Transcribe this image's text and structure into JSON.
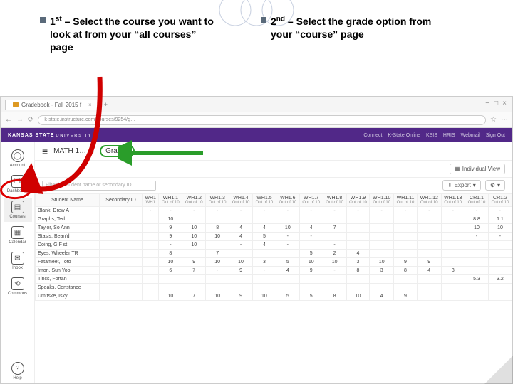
{
  "instructions": {
    "first": "1st – Select the course you want to look at from your “all courses” page",
    "second": "2nd – Select the grade option from  your “course” page"
  },
  "browser": {
    "tab_title": "Gradebook - Fall 2015 f",
    "url": "k-state.instructure.com/courses/9254/g…",
    "window_min": "−",
    "window_max": "□",
    "window_close": "×"
  },
  "ks": {
    "logo": "KANSAS STATE",
    "logo_sub": "U N I V E R S I T Y",
    "right_links": [
      "Connect",
      "K-State Online",
      "KSIS",
      "HRIS",
      "Webmail",
      "Sign Out"
    ]
  },
  "nav": [
    {
      "label": "Account",
      "glyph": "◯"
    },
    {
      "label": "Dashboard",
      "glyph": "❐"
    },
    {
      "label": "Courses",
      "glyph": "▤"
    },
    {
      "label": "Calendar",
      "glyph": "▦"
    },
    {
      "label": "Inbox",
      "glyph": "✉"
    },
    {
      "label": "Commons",
      "glyph": "⟲"
    },
    {
      "label": "Help",
      "glyph": "?"
    }
  ],
  "crumbs": {
    "course": "MATH 1…",
    "page": "Grades"
  },
  "toolbar": {
    "view": "Individual View",
    "export": "Export",
    "gear": "⚙",
    "chev": "▾",
    "grid": "▦"
  },
  "filter_placeholder": "Filter by student name or secondary ID",
  "grid": {
    "head_name": "Student Name",
    "head_sec": "Secondary ID",
    "columns": [
      "WH1",
      "WH1.1",
      "WH1.2",
      "WH1.3",
      "WH1.4",
      "WH1.5",
      "WH1.6",
      "WH1.7",
      "WH1.8",
      "WH1.9",
      "WH1.10",
      "WH1.11",
      "WH1.12",
      "WH1.13",
      "CR1.1",
      "CR1.2"
    ],
    "col_sub": "Out of 10",
    "col_sub_wh1": "WH1",
    "rows": [
      {
        "name": "Blank, Drew A",
        "sec": "",
        "c": [
          "-",
          "-",
          "-",
          "-",
          "-",
          "-",
          "-",
          "-",
          "-",
          "-",
          "-",
          "-",
          "-",
          "-",
          "-",
          "-"
        ]
      },
      {
        "name": "Graphs, Ted",
        "sec": "",
        "c": [
          "",
          "10",
          "",
          "",
          "",
          "",
          "",
          "",
          "",
          "",
          "",
          "",
          "",
          "",
          "8.8",
          "1.1"
        ]
      },
      {
        "name": "Taylor, So Ann",
        "sec": "",
        "c": [
          "",
          "9",
          "10",
          "8",
          "4",
          "4",
          "10",
          "4",
          "7",
          "",
          "",
          "",
          "",
          "",
          "10",
          "10"
        ]
      },
      {
        "name": "Stasis, Bean'd",
        "sec": "",
        "c": [
          "",
          "9",
          "10",
          "10",
          "4",
          "5",
          "-",
          "-",
          "",
          "",
          "",
          "",
          "",
          "",
          "-",
          "-"
        ]
      },
      {
        "name": "Doing, G F st",
        "sec": "",
        "c": [
          "",
          "-",
          "10",
          "",
          "-",
          "4",
          "-",
          "",
          "-",
          "",
          "",
          "",
          "",
          "",
          "",
          ""
        ]
      },
      {
        "name": "Eyes, Wheeler TR",
        "sec": "",
        "c": [
          "",
          "8",
          "",
          "7",
          "",
          "",
          "",
          "5",
          "2",
          "4",
          "",
          "",
          "",
          "",
          "",
          ""
        ]
      },
      {
        "name": "Fatameet, Toto",
        "sec": "",
        "c": [
          "",
          "10",
          "9",
          "10",
          "10",
          "3",
          "5",
          "10",
          "10",
          "3",
          "10",
          "9",
          "9",
          "",
          "",
          ""
        ]
      },
      {
        "name": "Imon, Sun Yoo",
        "sec": "",
        "c": [
          "",
          "6",
          "7",
          "-",
          "9",
          "-",
          "4",
          "9",
          "-",
          "8",
          "3",
          "8",
          "4",
          "3",
          "",
          ""
        ]
      },
      {
        "name": "Tincs, Fortan",
        "sec": "",
        "c": [
          "",
          "",
          "",
          "",
          "",
          "",
          "",
          "",
          "",
          "",
          "",
          "",
          "",
          "",
          "5.3",
          "3.2"
        ]
      },
      {
        "name": "Speaks, Constance",
        "sec": "",
        "c": [
          "",
          "",
          "",
          "",
          "",
          "",
          "",
          "",
          "",
          "",
          "",
          "",
          "",
          "",
          "",
          ""
        ]
      },
      {
        "name": "Umitske, Isky",
        "sec": "",
        "c": [
          "",
          "10",
          "7",
          "10",
          "9",
          "10",
          "5",
          "5",
          "8",
          "10",
          "4",
          "9",
          "",
          "",
          "",
          ""
        ]
      }
    ]
  }
}
